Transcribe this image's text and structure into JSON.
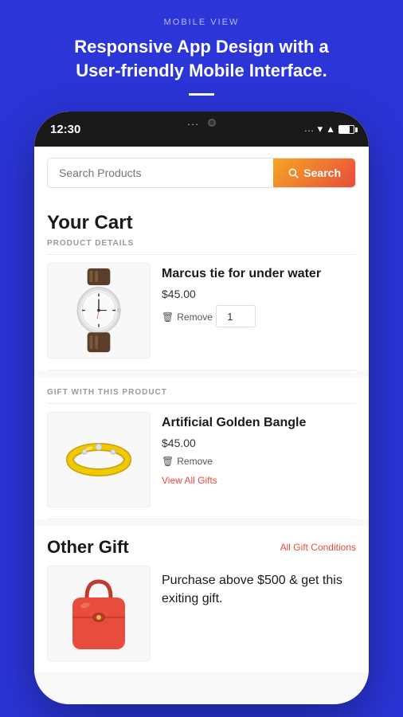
{
  "page": {
    "view_label": "MOBILE VIEW",
    "headline": "Responsive App Design with a User-friendly Mobile Interface.",
    "divider": true
  },
  "status_bar": {
    "time": "12:30",
    "notch_dots": "...",
    "signal_dots": "...",
    "wifi_symbol": "▼",
    "signal_bars": "▲"
  },
  "search": {
    "input_placeholder": "Search Products",
    "button_label": "Search"
  },
  "cart": {
    "title": "Your Cart",
    "product_details_label": "PRODUCT DETAILS",
    "items": [
      {
        "name": "Marcus tie for under water",
        "price": "$45.00",
        "remove_label": "Remove",
        "quantity": "1"
      }
    ],
    "gift_label": "GIFT WITH THIS PRODUCT",
    "gift_item": {
      "name": "Artificial Golden Bangle",
      "price": "$45.00",
      "remove_label": "Remove",
      "view_all_label": "View All Gifts"
    }
  },
  "other_gift": {
    "title": "Other Gift",
    "conditions_label": "All Gift Conditions",
    "description": "Purchase above $500 & get this exiting gift."
  },
  "colors": {
    "primary_blue": "#2b35d8",
    "accent_red": "#e84c3d",
    "accent_orange": "#f5a623",
    "text_dark": "#1a1a1a",
    "text_muted": "#999999"
  }
}
